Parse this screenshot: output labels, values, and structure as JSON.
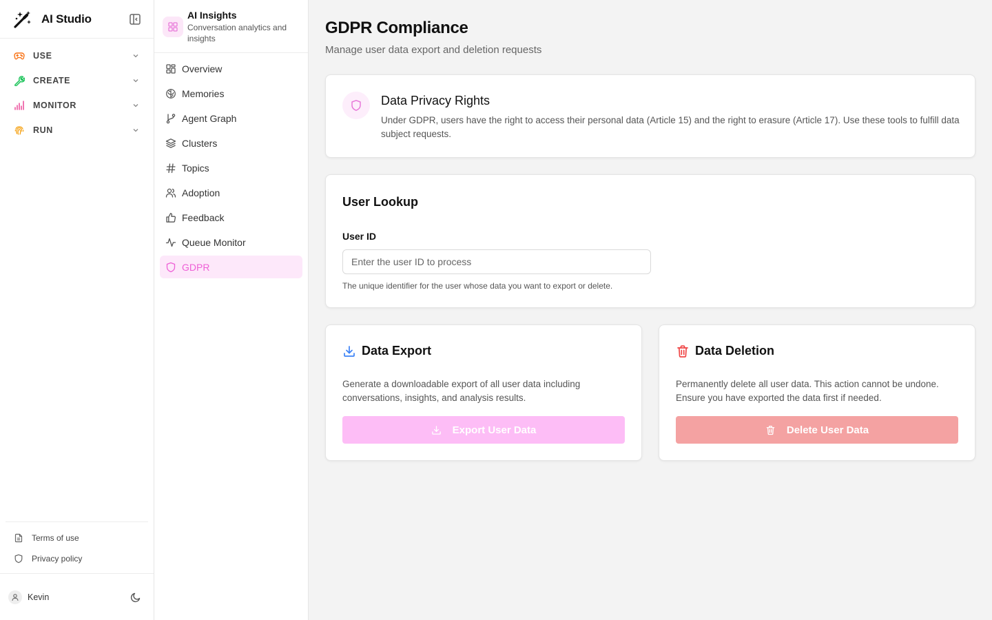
{
  "sidebar": {
    "brand": "AI Studio",
    "sections": [
      {
        "label": "USE",
        "icon": "gamepad-icon",
        "color": "#f97316"
      },
      {
        "label": "CREATE",
        "icon": "wrench-icon",
        "color": "#22c55e"
      },
      {
        "label": "MONITOR",
        "icon": "bar-chart-icon",
        "color": "#ec4899"
      },
      {
        "label": "RUN",
        "icon": "fingerprint-icon",
        "color": "#f59e0b"
      }
    ],
    "links": [
      {
        "label": "Terms of use",
        "icon": "file-text-icon"
      },
      {
        "label": "Privacy policy",
        "icon": "shield-icon"
      }
    ],
    "user": "Kevin"
  },
  "subnav": {
    "title": "AI Insights",
    "subtitle": "Conversation analytics and insights",
    "items": [
      {
        "label": "Overview",
        "icon": "layout-grid-icon"
      },
      {
        "label": "Memories",
        "icon": "brain-icon"
      },
      {
        "label": "Agent Graph",
        "icon": "git-branch-icon"
      },
      {
        "label": "Clusters",
        "icon": "layers-icon"
      },
      {
        "label": "Topics",
        "icon": "hash-icon"
      },
      {
        "label": "Adoption",
        "icon": "users-icon"
      },
      {
        "label": "Feedback",
        "icon": "thumbs-up-icon"
      },
      {
        "label": "Queue Monitor",
        "icon": "activity-icon"
      },
      {
        "label": "GDPR",
        "icon": "shield-icon",
        "active": true
      }
    ],
    "accent": "#ee5fd6"
  },
  "main": {
    "title": "GDPR Compliance",
    "subtitle": "Manage user data export and deletion requests",
    "privacy": {
      "title": "Data Privacy Rights",
      "text": "Under GDPR, users have the right to access their personal data (Article 15) and the right to erasure (Article 17). Use these tools to fulfill data subject requests."
    },
    "lookup": {
      "title": "User Lookup",
      "field_label": "User ID",
      "placeholder": "Enter the user ID to process",
      "value": "",
      "help": "The unique identifier for the user whose data you want to export or delete."
    },
    "export": {
      "title": "Data Export",
      "text": "Generate a downloadable export of all user data including conversations, insights, and analysis results.",
      "button": "Export User Data",
      "accent": "#3b82f6",
      "button_color": "#fdbdf6"
    },
    "delete": {
      "title": "Data Deletion",
      "text": "Permanently delete all user data. This action cannot be undone. Ensure you have exported the data first if needed.",
      "button": "Delete User Data",
      "accent": "#ef4444",
      "button_color": "#f4a2a2"
    }
  }
}
